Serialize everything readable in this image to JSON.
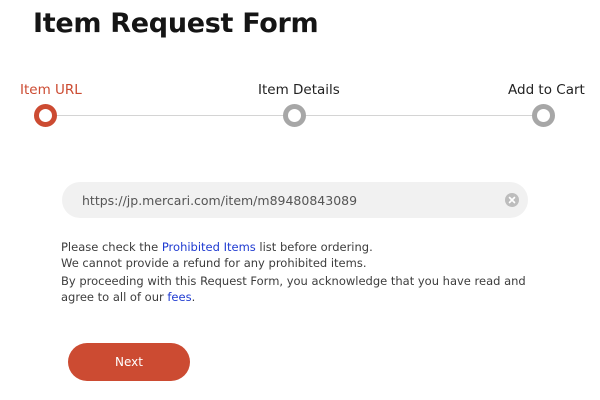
{
  "page": {
    "title": "Item Request Form"
  },
  "stepper": {
    "steps": [
      {
        "label": "Item URL",
        "state": "active"
      },
      {
        "label": "Item Details",
        "state": "inactive"
      },
      {
        "label": "Add to Cart",
        "state": "inactive"
      }
    ],
    "active_color": "#cc4b32",
    "inactive_color": "#a7a7a7"
  },
  "url_input": {
    "value": "https://jp.mercari.com/item/m89480843089",
    "clear_icon": "close-circle-icon"
  },
  "notice": {
    "line1_prefix": "Please check the ",
    "line1_link": "Prohibited Items",
    "line1_suffix": " list before ordering.",
    "line2": "We cannot provide a refund for any prohibited items.",
    "line3": "By proceeding with this Request Form, you acknowledge that you have read and",
    "line4_prefix": "agree to all of our ",
    "line4_link": "fees",
    "line4_suffix": "."
  },
  "actions": {
    "next_label": "Next"
  },
  "colors": {
    "accent": "#cc4b32",
    "link": "#1f3bd1"
  }
}
